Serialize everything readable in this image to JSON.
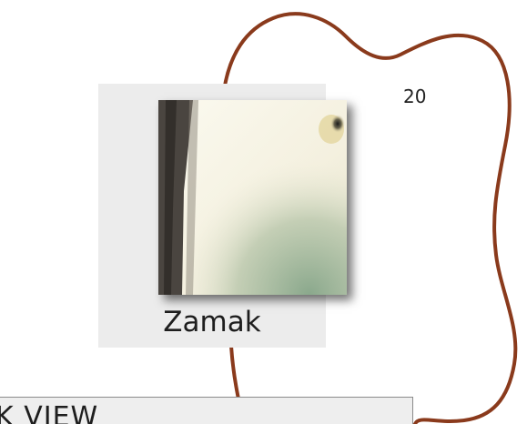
{
  "tile": {
    "caption": "Zamak",
    "image_icon": "photo-thumbnail"
  },
  "badge": {
    "value": "20",
    "outline_color": "#8a3a1c"
  },
  "viewbar": {
    "label": "K VIEW"
  },
  "colors": {
    "tile_background": "#ececec",
    "viewbar_background": "#eeeeee",
    "viewbar_border": "#8a8a8a"
  }
}
